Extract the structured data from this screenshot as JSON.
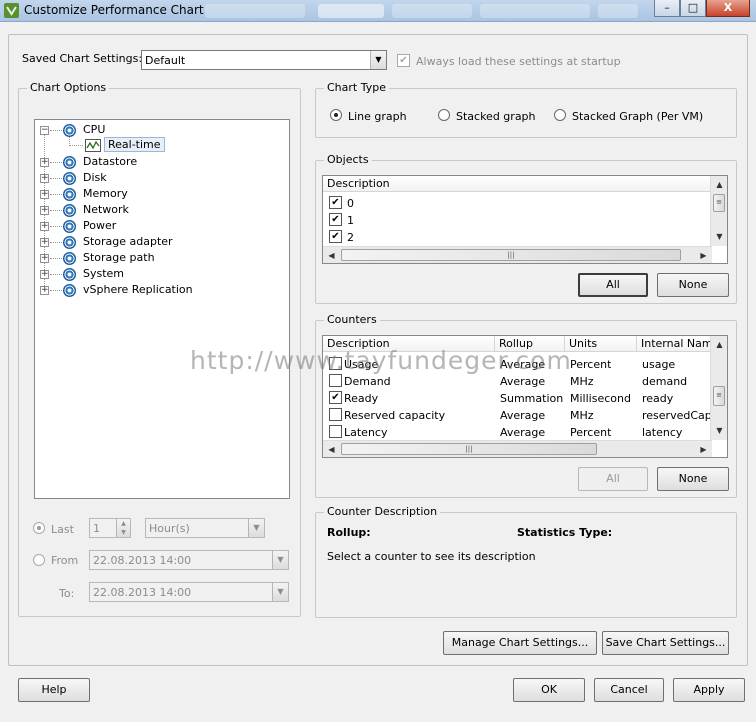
{
  "window": {
    "title": "Customize Performance Chart",
    "minimize": "–",
    "maximize": "□",
    "close": "X"
  },
  "saved": {
    "label": "Saved Chart Settings:",
    "value": "Default",
    "always_load_label": "Always load these settings at startup",
    "always_load_checked": true
  },
  "chart_options": {
    "title": "Chart Options",
    "tree": [
      {
        "label": "CPU",
        "expanded": true
      },
      {
        "label": "Real-time",
        "child": true
      },
      {
        "label": "Datastore"
      },
      {
        "label": "Disk"
      },
      {
        "label": "Memory"
      },
      {
        "label": "Network"
      },
      {
        "label": "Power"
      },
      {
        "label": "Storage adapter"
      },
      {
        "label": "Storage path"
      },
      {
        "label": "System"
      },
      {
        "label": "vSphere Replication"
      }
    ],
    "last_label": "Last",
    "last_value": "1",
    "unit_value": "Hour(s)",
    "from_label": "From",
    "from_value": "22.08.2013 14:00",
    "to_label": "To:",
    "to_value": "22.08.2013 14:00"
  },
  "chart_type": {
    "title": "Chart Type",
    "options": [
      "Line graph",
      "Stacked graph",
      "Stacked Graph (Per VM)"
    ],
    "selected": 0
  },
  "objects": {
    "title": "Objects",
    "header": "Description",
    "rows": [
      "0",
      "1",
      "2"
    ],
    "all_label": "All",
    "none_label": "None"
  },
  "counters": {
    "title": "Counters",
    "headers": [
      "Description",
      "Rollup",
      "Units",
      "Internal Name"
    ],
    "rows": [
      {
        "checked": false,
        "cells": [
          "Usage",
          "Average",
          "Percent",
          "usage"
        ]
      },
      {
        "checked": false,
        "cells": [
          "Demand",
          "Average",
          "MHz",
          "demand"
        ]
      },
      {
        "checked": true,
        "cells": [
          "Ready",
          "Summation",
          "Millisecond",
          "ready"
        ]
      },
      {
        "checked": false,
        "cells": [
          "Reserved capacity",
          "Average",
          "MHz",
          "reservedCapacity"
        ]
      },
      {
        "checked": false,
        "cells": [
          "Latency",
          "Average",
          "Percent",
          "latency"
        ]
      }
    ],
    "all_label": "All",
    "none_label": "None"
  },
  "counter_description": {
    "title": "Counter Description",
    "rollup_label": "Rollup:",
    "stats_type_label": "Statistics Type:",
    "hint": "Select a counter to see its description"
  },
  "actions": {
    "manage": "Manage Chart Settings...",
    "save": "Save Chart Settings...",
    "help": "Help",
    "ok": "OK",
    "cancel": "Cancel",
    "apply": "Apply"
  },
  "watermark": "http://www.tayfundeger.com"
}
